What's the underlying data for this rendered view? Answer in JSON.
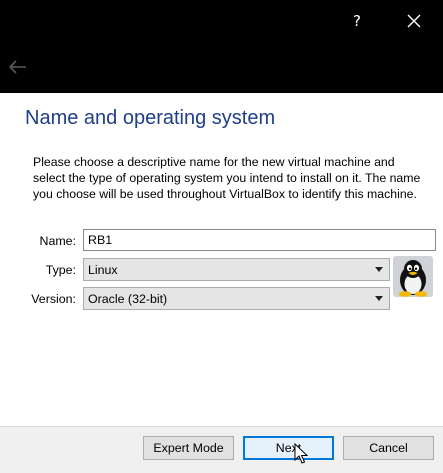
{
  "titlebar": {
    "help_label": "?"
  },
  "page": {
    "heading": "Name and operating system",
    "description": "Please choose a descriptive name for the new virtual machine and select the type of operating system you intend to install on it. The name you choose will be used throughout VirtualBox to identify this machine."
  },
  "form": {
    "name_label": "Name:",
    "name_value": "RB1",
    "type_label": "Type:",
    "type_value": "Linux",
    "version_label": "Version:",
    "version_value": "Oracle (32-bit)"
  },
  "buttons": {
    "expert_mode": "Expert Mode",
    "next": "Next",
    "cancel": "Cancel"
  },
  "icons": {
    "help": "help-icon",
    "close": "close-icon",
    "back": "back-arrow-icon",
    "os": "linux-penguin-icon"
  },
  "colors": {
    "heading": "#1f3f86",
    "titlebar": "#000000",
    "primary_button_border": "#0078d7"
  }
}
